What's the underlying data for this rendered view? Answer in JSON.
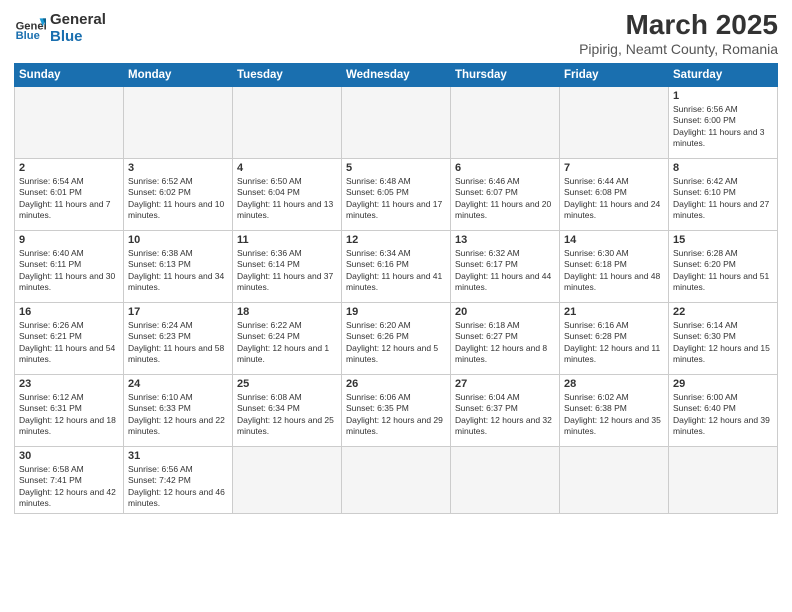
{
  "header": {
    "logo_general": "General",
    "logo_blue": "Blue",
    "title": "March 2025",
    "subtitle": "Pipirig, Neamt County, Romania"
  },
  "weekdays": [
    "Sunday",
    "Monday",
    "Tuesday",
    "Wednesday",
    "Thursday",
    "Friday",
    "Saturday"
  ],
  "weeks": [
    [
      {
        "day": "",
        "info": ""
      },
      {
        "day": "",
        "info": ""
      },
      {
        "day": "",
        "info": ""
      },
      {
        "day": "",
        "info": ""
      },
      {
        "day": "",
        "info": ""
      },
      {
        "day": "",
        "info": ""
      },
      {
        "day": "1",
        "info": "Sunrise: 6:56 AM\nSunset: 6:00 PM\nDaylight: 11 hours and 3 minutes."
      }
    ],
    [
      {
        "day": "2",
        "info": "Sunrise: 6:54 AM\nSunset: 6:01 PM\nDaylight: 11 hours and 7 minutes."
      },
      {
        "day": "3",
        "info": "Sunrise: 6:52 AM\nSunset: 6:02 PM\nDaylight: 11 hours and 10 minutes."
      },
      {
        "day": "4",
        "info": "Sunrise: 6:50 AM\nSunset: 6:04 PM\nDaylight: 11 hours and 13 minutes."
      },
      {
        "day": "5",
        "info": "Sunrise: 6:48 AM\nSunset: 6:05 PM\nDaylight: 11 hours and 17 minutes."
      },
      {
        "day": "6",
        "info": "Sunrise: 6:46 AM\nSunset: 6:07 PM\nDaylight: 11 hours and 20 minutes."
      },
      {
        "day": "7",
        "info": "Sunrise: 6:44 AM\nSunset: 6:08 PM\nDaylight: 11 hours and 24 minutes."
      },
      {
        "day": "8",
        "info": "Sunrise: 6:42 AM\nSunset: 6:10 PM\nDaylight: 11 hours and 27 minutes."
      }
    ],
    [
      {
        "day": "9",
        "info": "Sunrise: 6:40 AM\nSunset: 6:11 PM\nDaylight: 11 hours and 30 minutes."
      },
      {
        "day": "10",
        "info": "Sunrise: 6:38 AM\nSunset: 6:13 PM\nDaylight: 11 hours and 34 minutes."
      },
      {
        "day": "11",
        "info": "Sunrise: 6:36 AM\nSunset: 6:14 PM\nDaylight: 11 hours and 37 minutes."
      },
      {
        "day": "12",
        "info": "Sunrise: 6:34 AM\nSunset: 6:16 PM\nDaylight: 11 hours and 41 minutes."
      },
      {
        "day": "13",
        "info": "Sunrise: 6:32 AM\nSunset: 6:17 PM\nDaylight: 11 hours and 44 minutes."
      },
      {
        "day": "14",
        "info": "Sunrise: 6:30 AM\nSunset: 6:18 PM\nDaylight: 11 hours and 48 minutes."
      },
      {
        "day": "15",
        "info": "Sunrise: 6:28 AM\nSunset: 6:20 PM\nDaylight: 11 hours and 51 minutes."
      }
    ],
    [
      {
        "day": "16",
        "info": "Sunrise: 6:26 AM\nSunset: 6:21 PM\nDaylight: 11 hours and 54 minutes."
      },
      {
        "day": "17",
        "info": "Sunrise: 6:24 AM\nSunset: 6:23 PM\nDaylight: 11 hours and 58 minutes."
      },
      {
        "day": "18",
        "info": "Sunrise: 6:22 AM\nSunset: 6:24 PM\nDaylight: 12 hours and 1 minute."
      },
      {
        "day": "19",
        "info": "Sunrise: 6:20 AM\nSunset: 6:26 PM\nDaylight: 12 hours and 5 minutes."
      },
      {
        "day": "20",
        "info": "Sunrise: 6:18 AM\nSunset: 6:27 PM\nDaylight: 12 hours and 8 minutes."
      },
      {
        "day": "21",
        "info": "Sunrise: 6:16 AM\nSunset: 6:28 PM\nDaylight: 12 hours and 11 minutes."
      },
      {
        "day": "22",
        "info": "Sunrise: 6:14 AM\nSunset: 6:30 PM\nDaylight: 12 hours and 15 minutes."
      }
    ],
    [
      {
        "day": "23",
        "info": "Sunrise: 6:12 AM\nSunset: 6:31 PM\nDaylight: 12 hours and 18 minutes."
      },
      {
        "day": "24",
        "info": "Sunrise: 6:10 AM\nSunset: 6:33 PM\nDaylight: 12 hours and 22 minutes."
      },
      {
        "day": "25",
        "info": "Sunrise: 6:08 AM\nSunset: 6:34 PM\nDaylight: 12 hours and 25 minutes."
      },
      {
        "day": "26",
        "info": "Sunrise: 6:06 AM\nSunset: 6:35 PM\nDaylight: 12 hours and 29 minutes."
      },
      {
        "day": "27",
        "info": "Sunrise: 6:04 AM\nSunset: 6:37 PM\nDaylight: 12 hours and 32 minutes."
      },
      {
        "day": "28",
        "info": "Sunrise: 6:02 AM\nSunset: 6:38 PM\nDaylight: 12 hours and 35 minutes."
      },
      {
        "day": "29",
        "info": "Sunrise: 6:00 AM\nSunset: 6:40 PM\nDaylight: 12 hours and 39 minutes."
      }
    ],
    [
      {
        "day": "30",
        "info": "Sunrise: 6:58 AM\nSunset: 7:41 PM\nDaylight: 12 hours and 42 minutes."
      },
      {
        "day": "31",
        "info": "Sunrise: 6:56 AM\nSunset: 7:42 PM\nDaylight: 12 hours and 46 minutes."
      },
      {
        "day": "",
        "info": ""
      },
      {
        "day": "",
        "info": ""
      },
      {
        "day": "",
        "info": ""
      },
      {
        "day": "",
        "info": ""
      },
      {
        "day": "",
        "info": ""
      }
    ]
  ]
}
